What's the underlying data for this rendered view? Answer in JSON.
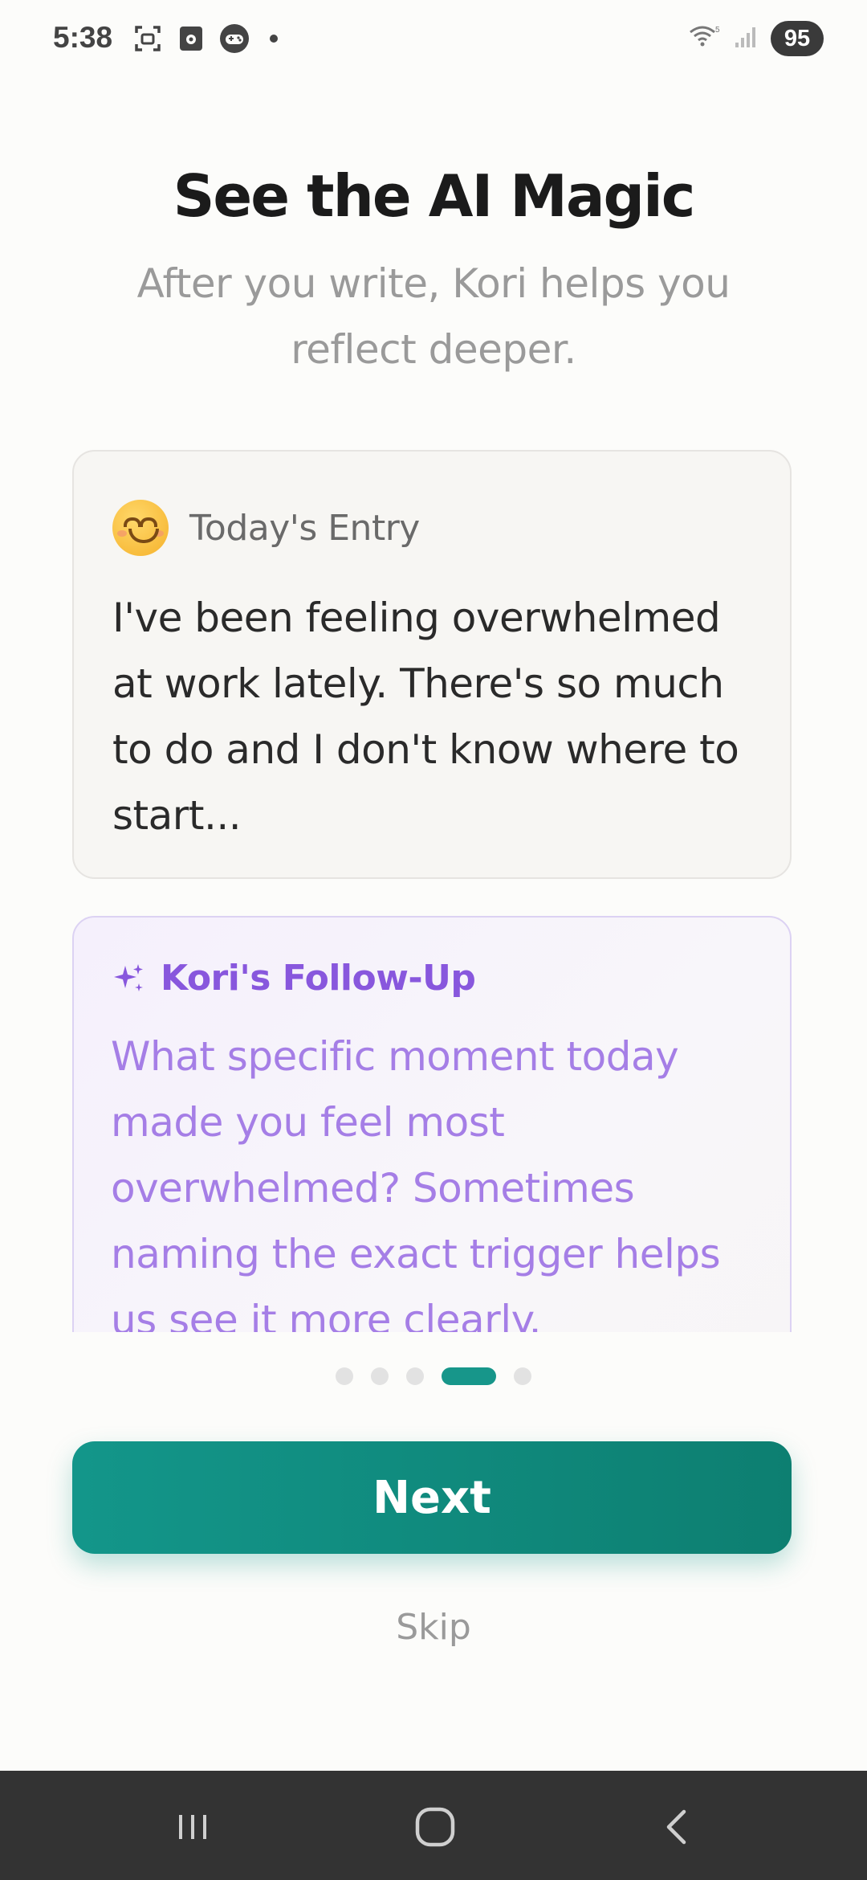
{
  "status_bar": {
    "time": "5:38",
    "battery": "95",
    "left_icons": [
      "screenshot-icon",
      "media-icon",
      "game-icon",
      "notification-dot"
    ],
    "right_icons": [
      "wifi-icon",
      "signal-icon",
      "battery-icon"
    ]
  },
  "header": {
    "title": "See the AI Magic",
    "subtitle": "After you write, Kori helps you reflect deeper."
  },
  "entry_card": {
    "icon": "smiling-face-icon",
    "label": "Today's Entry",
    "text": "I've been feeling overwhelmed at work lately. There's so much to do and I don't know where to start..."
  },
  "followup_card": {
    "icon": "sparkle-icon",
    "label": "Kori's Follow-Up",
    "text": "What specific moment today made you feel most overwhelmed? Sometimes naming the exact trigger helps us see it more clearly."
  },
  "pager": {
    "total": 5,
    "active_index": 3
  },
  "actions": {
    "next_label": "Next",
    "skip_label": "Skip"
  },
  "colors": {
    "accent": "#17968a",
    "followup_accent": "#8857dd",
    "nav_bar": "#333333"
  }
}
